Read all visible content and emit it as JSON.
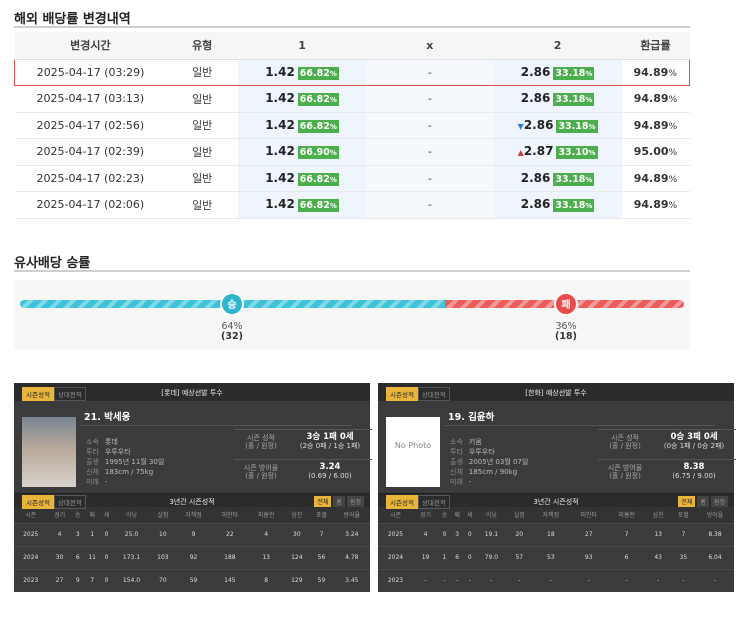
{
  "odds_section": {
    "title": "해외 배당률 변경내역",
    "headers": [
      "변경시간",
      "유형",
      "1",
      "x",
      "2",
      "환급률"
    ],
    "rows": [
      {
        "time": "2025-04-17 (03:29)",
        "type": "일반",
        "o1": "1.42",
        "p1": "66.82",
        "x": "-",
        "o2": "2.86",
        "p2": "33.18",
        "ret": "94.89",
        "arrow": ""
      },
      {
        "time": "2025-04-17 (03:13)",
        "type": "일반",
        "o1": "1.42",
        "p1": "66.82",
        "x": "-",
        "o2": "2.86",
        "p2": "33.18",
        "ret": "94.89",
        "arrow": ""
      },
      {
        "time": "2025-04-17 (02:56)",
        "type": "일반",
        "o1": "1.42",
        "p1": "66.82",
        "x": "-",
        "o2": "2.86",
        "p2": "33.18",
        "ret": "94.89",
        "arrow": "▼"
      },
      {
        "time": "2025-04-17 (02:39)",
        "type": "일반",
        "o1": "1.42",
        "p1": "66.90",
        "x": "-",
        "o2": "2.87",
        "p2": "33.10",
        "ret": "95.00",
        "arrow": "▲"
      },
      {
        "time": "2025-04-17 (02:23)",
        "type": "일반",
        "o1": "1.42",
        "p1": "66.82",
        "x": "-",
        "o2": "2.86",
        "p2": "33.18",
        "ret": "94.89",
        "arrow": ""
      },
      {
        "time": "2025-04-17 (02:06)",
        "type": "일반",
        "o1": "1.42",
        "p1": "66.82",
        "x": "-",
        "o2": "2.86",
        "p2": "33.18",
        "ret": "94.89",
        "arrow": ""
      }
    ],
    "pct_unit": "%"
  },
  "similar_section": {
    "title": "유사배당 승률",
    "win_label": "승",
    "lose_label": "패",
    "win_pct": "64%",
    "win_count": "(32)",
    "lose_pct": "36%",
    "lose_count": "(18)",
    "win_fraction": 0.64
  },
  "panels": [
    {
      "tab_on": "시즌성적",
      "tab_off": "상대전적",
      "title": "[롯데] 예상선발 투수",
      "name": "21. 박세웅",
      "photo": "",
      "info": [
        [
          "소속",
          "롯데"
        ],
        [
          "투타",
          "우투우타"
        ],
        [
          "출생",
          "1995년 11월 30일"
        ],
        [
          "신체",
          "183cm / 75kg"
        ],
        [
          "미래",
          "-"
        ]
      ],
      "season_label1": "시즌 성적",
      "season_label2": "(홀 / 원정)",
      "season_main": "3승 1패 0세",
      "season_sub": "(2승 0패 / 1승 1패)",
      "era_label1": "시즌 방어율",
      "era_label2": "(홀 / 원정)",
      "era_main": "3.24",
      "era_sub": "(0.69 / 6.00)",
      "mid_title": "3년간 시즌성적",
      "filters": [
        "전체",
        "홈",
        "원정"
      ],
      "cols": [
        "시즌",
        "경기",
        "승",
        "패",
        "세",
        "이닝",
        "실점",
        "자책점",
        "피안타",
        "피홈런",
        "삼진",
        "포볼",
        "방어율"
      ],
      "rows": [
        [
          "2025",
          "4",
          "3",
          "1",
          "0",
          "25.0",
          "10",
          "9",
          "22",
          "4",
          "30",
          "7",
          "3.24"
        ],
        [
          "2024",
          "30",
          "6",
          "11",
          "0",
          "173.1",
          "103",
          "92",
          "188",
          "13",
          "124",
          "56",
          "4.78"
        ],
        [
          "2023",
          "27",
          "9",
          "7",
          "0",
          "154.0",
          "70",
          "59",
          "145",
          "8",
          "129",
          "59",
          "3.45"
        ]
      ]
    },
    {
      "tab_on": "시즌성적",
      "tab_off": "상대전적",
      "title": "[한화] 예상선발 투수",
      "name": "19. 김윤하",
      "photo": "No Photo",
      "info": [
        [
          "소속",
          "키움"
        ],
        [
          "투타",
          "우투우타"
        ],
        [
          "출생",
          "2005년 03월 07일"
        ],
        [
          "신체",
          "185cm / 90kg"
        ],
        [
          "미래",
          "-"
        ]
      ],
      "season_label1": "시즌 성적",
      "season_label2": "(홀 / 원정)",
      "season_main": "0승 3패 0세",
      "season_sub": "(0승 1패 / 0승 2패)",
      "era_label1": "시즌 방어율",
      "era_label2": "(홀 / 원정)",
      "era_main": "8.38",
      "era_sub": "(6.75 / 9.00)",
      "mid_title": "3년간 시즌성적",
      "filters": [
        "전체",
        "홈",
        "원정"
      ],
      "cols": [
        "시즌",
        "경기",
        "승",
        "패",
        "세",
        "이닝",
        "실점",
        "자책점",
        "피안타",
        "피홈런",
        "삼진",
        "포볼",
        "방어율"
      ],
      "rows": [
        [
          "2025",
          "4",
          "0",
          "3",
          "0",
          "19.1",
          "20",
          "18",
          "27",
          "7",
          "13",
          "7",
          "8.38"
        ],
        [
          "2024",
          "19",
          "1",
          "6",
          "0",
          "79.0",
          "57",
          "53",
          "93",
          "6",
          "43",
          "35",
          "6.04"
        ],
        [
          "2023",
          "-",
          "-",
          "-",
          "-",
          "-",
          "-",
          "-",
          "-",
          "-",
          "-",
          "-",
          "-"
        ]
      ]
    }
  ]
}
